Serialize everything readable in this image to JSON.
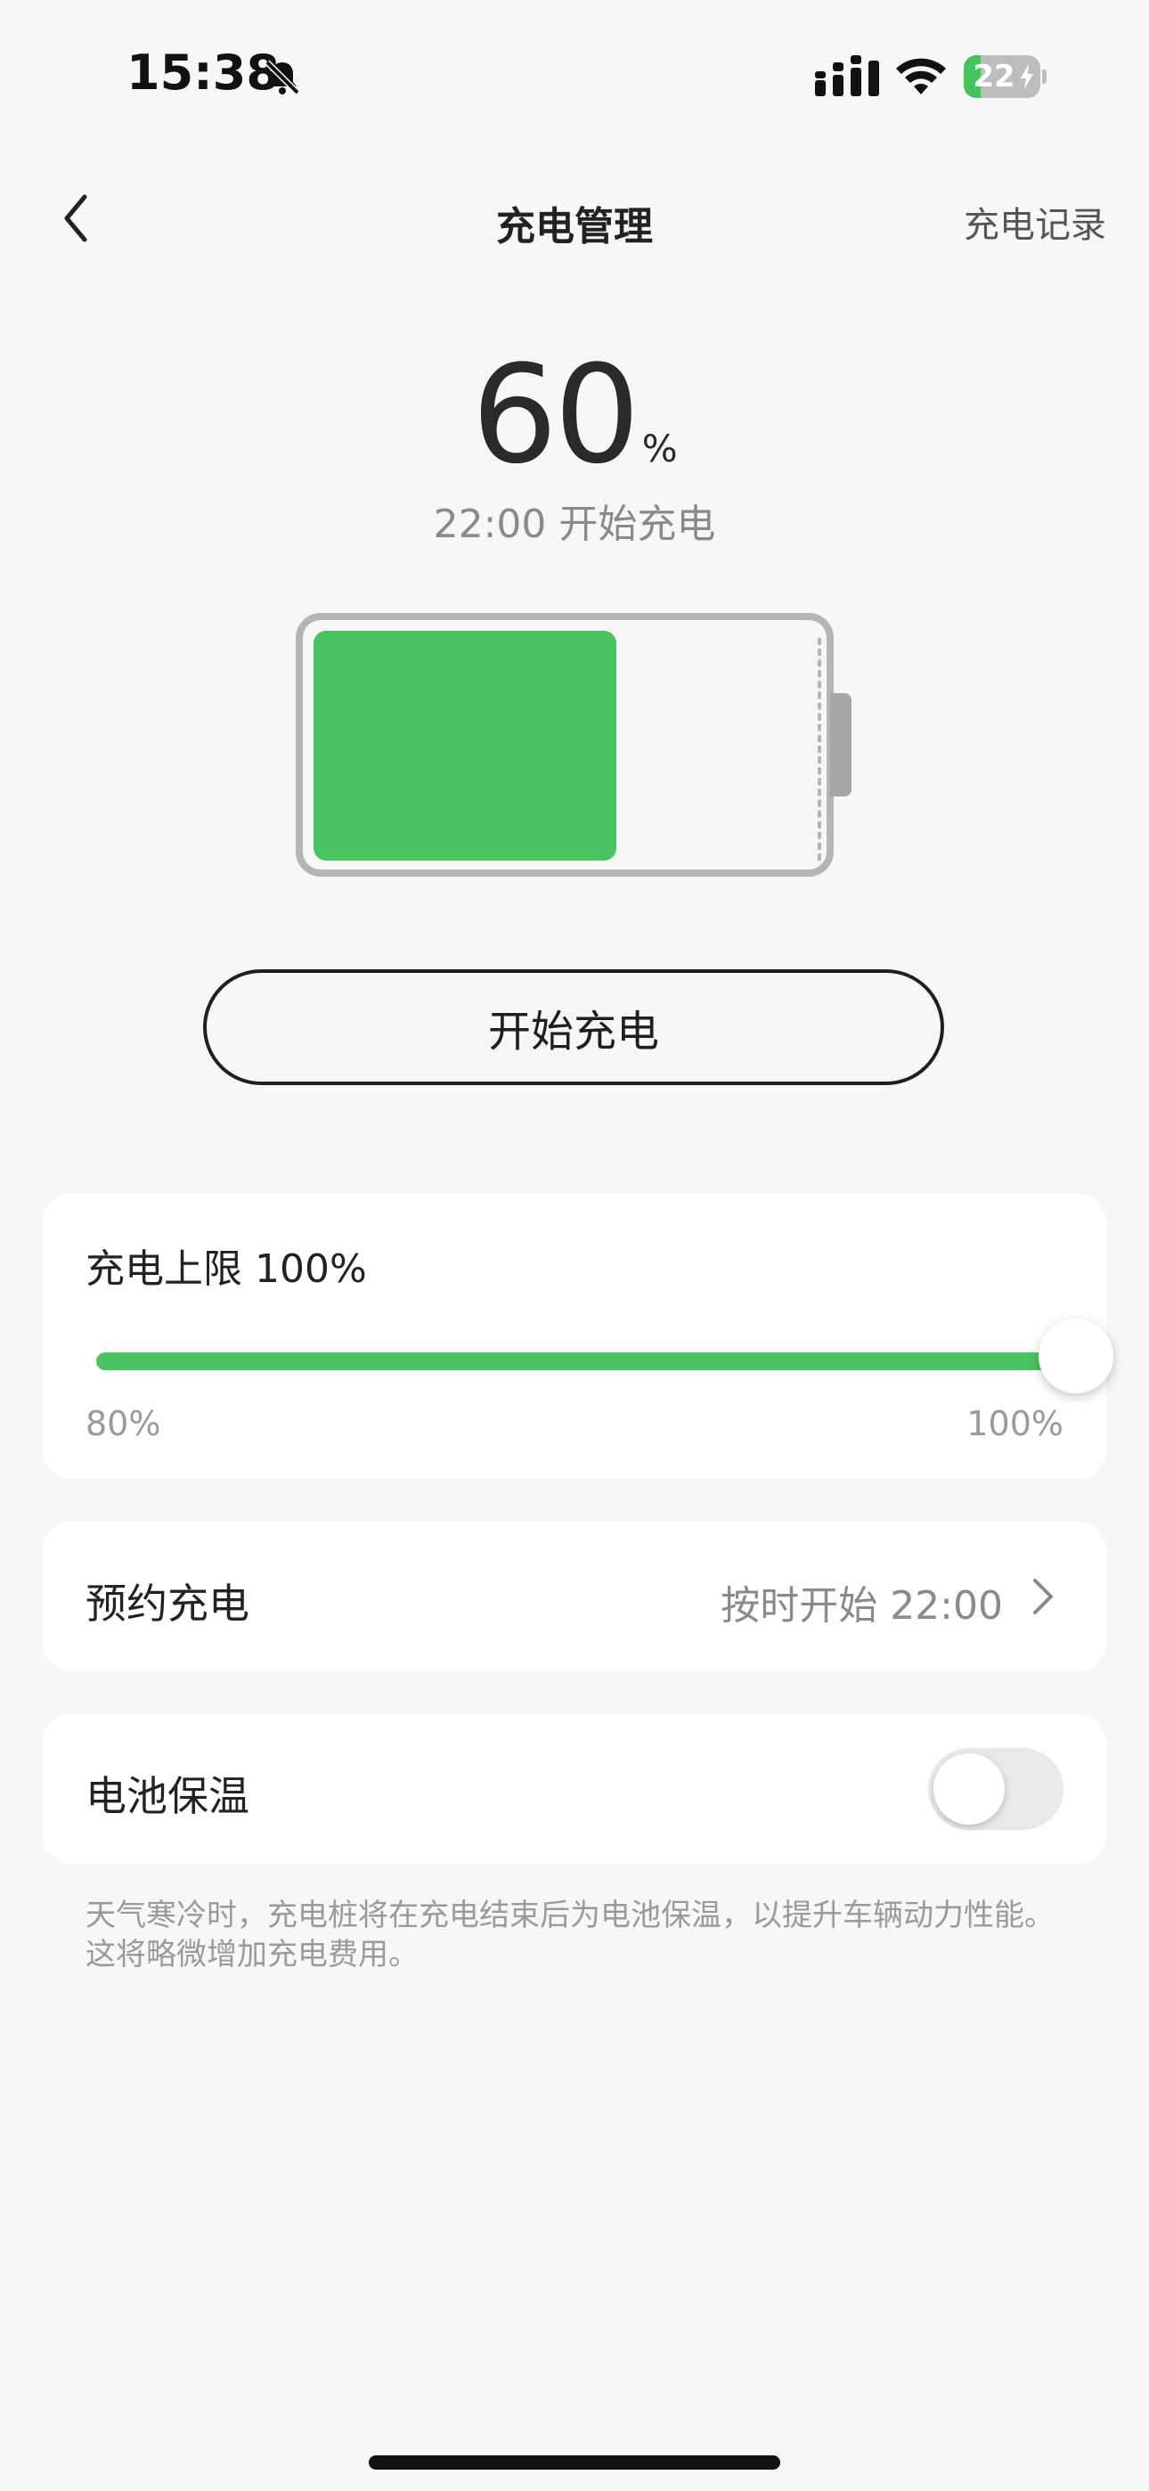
{
  "status_bar": {
    "time": "15:38",
    "silent_icon": "bell-slash-icon",
    "signal_icon": "cellular-signal-icon",
    "wifi_icon": "wifi-icon",
    "battery": {
      "percent_text": "22",
      "level": 0.22,
      "charging": true,
      "color": "#45c35d"
    }
  },
  "nav": {
    "back_icon": "chevron-left-icon",
    "title": "充电管理",
    "right_link": "充电记录"
  },
  "charge": {
    "percent": "60",
    "unit": "%",
    "level": 0.6,
    "subtitle": "22:00 开始充电",
    "fill_color": "#4ac460"
  },
  "start_button": {
    "label": "开始充电"
  },
  "limit_card": {
    "title": "充电上限 100%",
    "min_label": "80%",
    "max_label": "100%",
    "value_fraction": 1.0,
    "accent_color": "#4ac460"
  },
  "schedule_row": {
    "label": "预约充电",
    "value": "按时开始 22:00",
    "chevron_icon": "chevron-right-icon"
  },
  "heat_row": {
    "label": "电池保温",
    "toggle_on": false
  },
  "footnote": "天气寒冷时，充电桩将在充电结束后为电池保温，以提升车辆动力性能。这将略微增加充电费用。"
}
